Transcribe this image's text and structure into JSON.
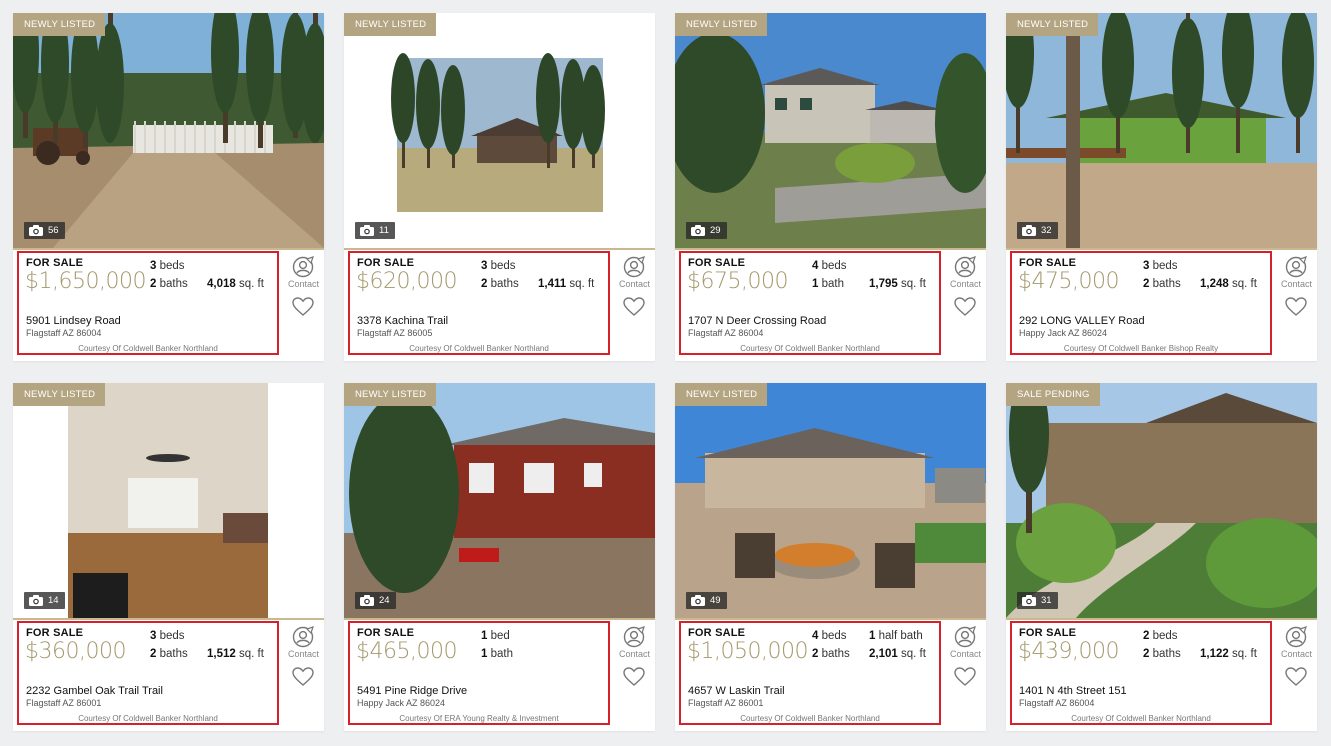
{
  "listings": [
    {
      "tag": "NEWLY LISTED",
      "photos": "56",
      "status": "FOR SALE",
      "price": "$1,650,000",
      "beds_n": "3",
      "beds_u": "beds",
      "baths_n": "2",
      "baths_u": "baths",
      "half_n": "",
      "half_u": "",
      "sqft_n": "4,018",
      "sqft_u": "sq. ft",
      "address": "5901 Lindsey Road",
      "city": "Flagstaff AZ 86004",
      "courtesy": "Courtesy Of Coldwell Banker Northland",
      "contact": "Contact"
    },
    {
      "tag": "NEWLY LISTED",
      "photos": "11",
      "status": "FOR SALE",
      "price": "$620,000",
      "beds_n": "3",
      "beds_u": "beds",
      "baths_n": "2",
      "baths_u": "baths",
      "half_n": "",
      "half_u": "",
      "sqft_n": "1,411",
      "sqft_u": "sq. ft",
      "address": "3378 Kachina Trail",
      "city": "Flagstaff AZ 86005",
      "courtesy": "Courtesy Of Coldwell Banker Northland",
      "contact": "Contact"
    },
    {
      "tag": "NEWLY LISTED",
      "photos": "29",
      "status": "FOR SALE",
      "price": "$675,000",
      "beds_n": "4",
      "beds_u": "beds",
      "baths_n": "1",
      "baths_u": "bath",
      "half_n": "",
      "half_u": "",
      "sqft_n": "1,795",
      "sqft_u": "sq. ft",
      "address": "1707 N Deer Crossing Road",
      "city": "Flagstaff AZ 86004",
      "courtesy": "Courtesy Of Coldwell Banker Northland",
      "contact": "Contact"
    },
    {
      "tag": "NEWLY LISTED",
      "photos": "32",
      "status": "FOR SALE",
      "price": "$475,000",
      "beds_n": "3",
      "beds_u": "beds",
      "baths_n": "2",
      "baths_u": "baths",
      "half_n": "",
      "half_u": "",
      "sqft_n": "1,248",
      "sqft_u": "sq. ft",
      "address": "292 LONG VALLEY Road",
      "city": "Happy Jack AZ 86024",
      "courtesy": "Courtesy Of Coldwell Banker Bishop Realty",
      "contact": "Contact"
    },
    {
      "tag": "NEWLY LISTED",
      "photos": "14",
      "status": "FOR SALE",
      "price": "$360,000",
      "beds_n": "3",
      "beds_u": "beds",
      "baths_n": "2",
      "baths_u": "baths",
      "half_n": "",
      "half_u": "",
      "sqft_n": "1,512",
      "sqft_u": "sq. ft",
      "address": "2232 Gambel Oak Trail Trail",
      "city": "Flagstaff AZ 86001",
      "courtesy": "Courtesy Of Coldwell Banker Northland",
      "contact": "Contact"
    },
    {
      "tag": "NEWLY LISTED",
      "photos": "24",
      "status": "FOR SALE",
      "price": "$465,000",
      "beds_n": "1",
      "beds_u": "bed",
      "baths_n": "1",
      "baths_u": "bath",
      "half_n": "",
      "half_u": "",
      "sqft_n": "",
      "sqft_u": "",
      "address": "5491 Pine Ridge Drive",
      "city": "Happy Jack AZ 86024",
      "courtesy": "Courtesy Of ERA Young Realty & Investment",
      "contact": "Contact"
    },
    {
      "tag": "NEWLY LISTED",
      "photos": "49",
      "status": "FOR SALE",
      "price": "$1,050,000",
      "beds_n": "4",
      "beds_u": "beds",
      "baths_n": "2",
      "baths_u": "baths",
      "half_n": "1",
      "half_u": "half bath",
      "sqft_n": "2,101",
      "sqft_u": "sq. ft",
      "address": "4657 W Laskin Trail",
      "city": "Flagstaff AZ 86001",
      "courtesy": "Courtesy Of Coldwell Banker Northland",
      "contact": "Contact"
    },
    {
      "tag": "SALE PENDING",
      "photos": "31",
      "status": "FOR SALE",
      "price": "$439,000",
      "beds_n": "2",
      "beds_u": "beds",
      "baths_n": "2",
      "baths_u": "baths",
      "half_n": "",
      "half_u": "",
      "sqft_n": "1,122",
      "sqft_u": "sq. ft",
      "address": "1401 N 4th Street 151",
      "city": "Flagstaff AZ 86004",
      "courtesy": "Courtesy Of Coldwell Banker Northland",
      "contact": "Contact"
    }
  ],
  "colors": {
    "accent": "#b4a582",
    "price": "#a4986c",
    "highlight": "#d6212c"
  },
  "icons": {
    "photo_count": "camera-icon",
    "contact": "contact-agent-icon",
    "favorite": "heart-icon"
  }
}
